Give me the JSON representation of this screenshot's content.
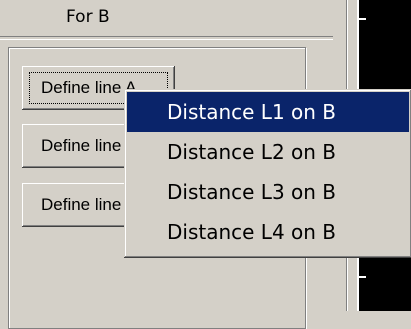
{
  "panel": {
    "label": "For B"
  },
  "buttons": {
    "define_a": "Define line A",
    "define_b": "Define line B",
    "define_c": "Define line C"
  },
  "context_menu": {
    "items": [
      {
        "label": "Distance L1 on B",
        "selected": true
      },
      {
        "label": "Distance L2 on B",
        "selected": false
      },
      {
        "label": "Distance L3 on B",
        "selected": false
      },
      {
        "label": "Distance L4 on B",
        "selected": false
      }
    ]
  },
  "colors": {
    "face": "#d4d0c8",
    "highlight": "#0a246a",
    "viewport": "#000000"
  }
}
